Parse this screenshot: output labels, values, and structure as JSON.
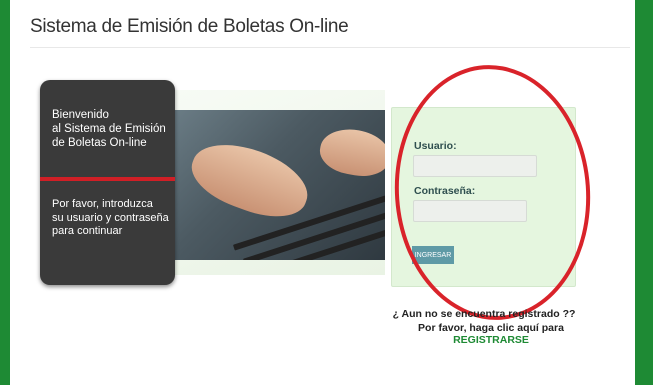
{
  "page": {
    "title": "Sistema de Emisión de Boletas On-line"
  },
  "welcome": {
    "line1": "Bienvenido",
    "line2": "al Sistema de Emisión",
    "line3": "de Boletas On-line",
    "instr1": "Por favor, introduzca",
    "instr2": "su usuario y contraseña",
    "instr3": "para continuar"
  },
  "login": {
    "user_label": "Usuario:",
    "user_value": "",
    "password_label": "Contraseña:",
    "password_value": "",
    "submit_label": "INGRESAR"
  },
  "register": {
    "question": "¿ Aun no se encuentra registrado ??",
    "prompt": "Por favor, haga clic aquí para ",
    "link_label": "REGISTRARSE"
  },
  "colors": {
    "frame_green": "#1e8a34",
    "annotation_red": "#d9232a",
    "button_teal": "#5f9aa6",
    "login_bg": "#e5f6df"
  }
}
